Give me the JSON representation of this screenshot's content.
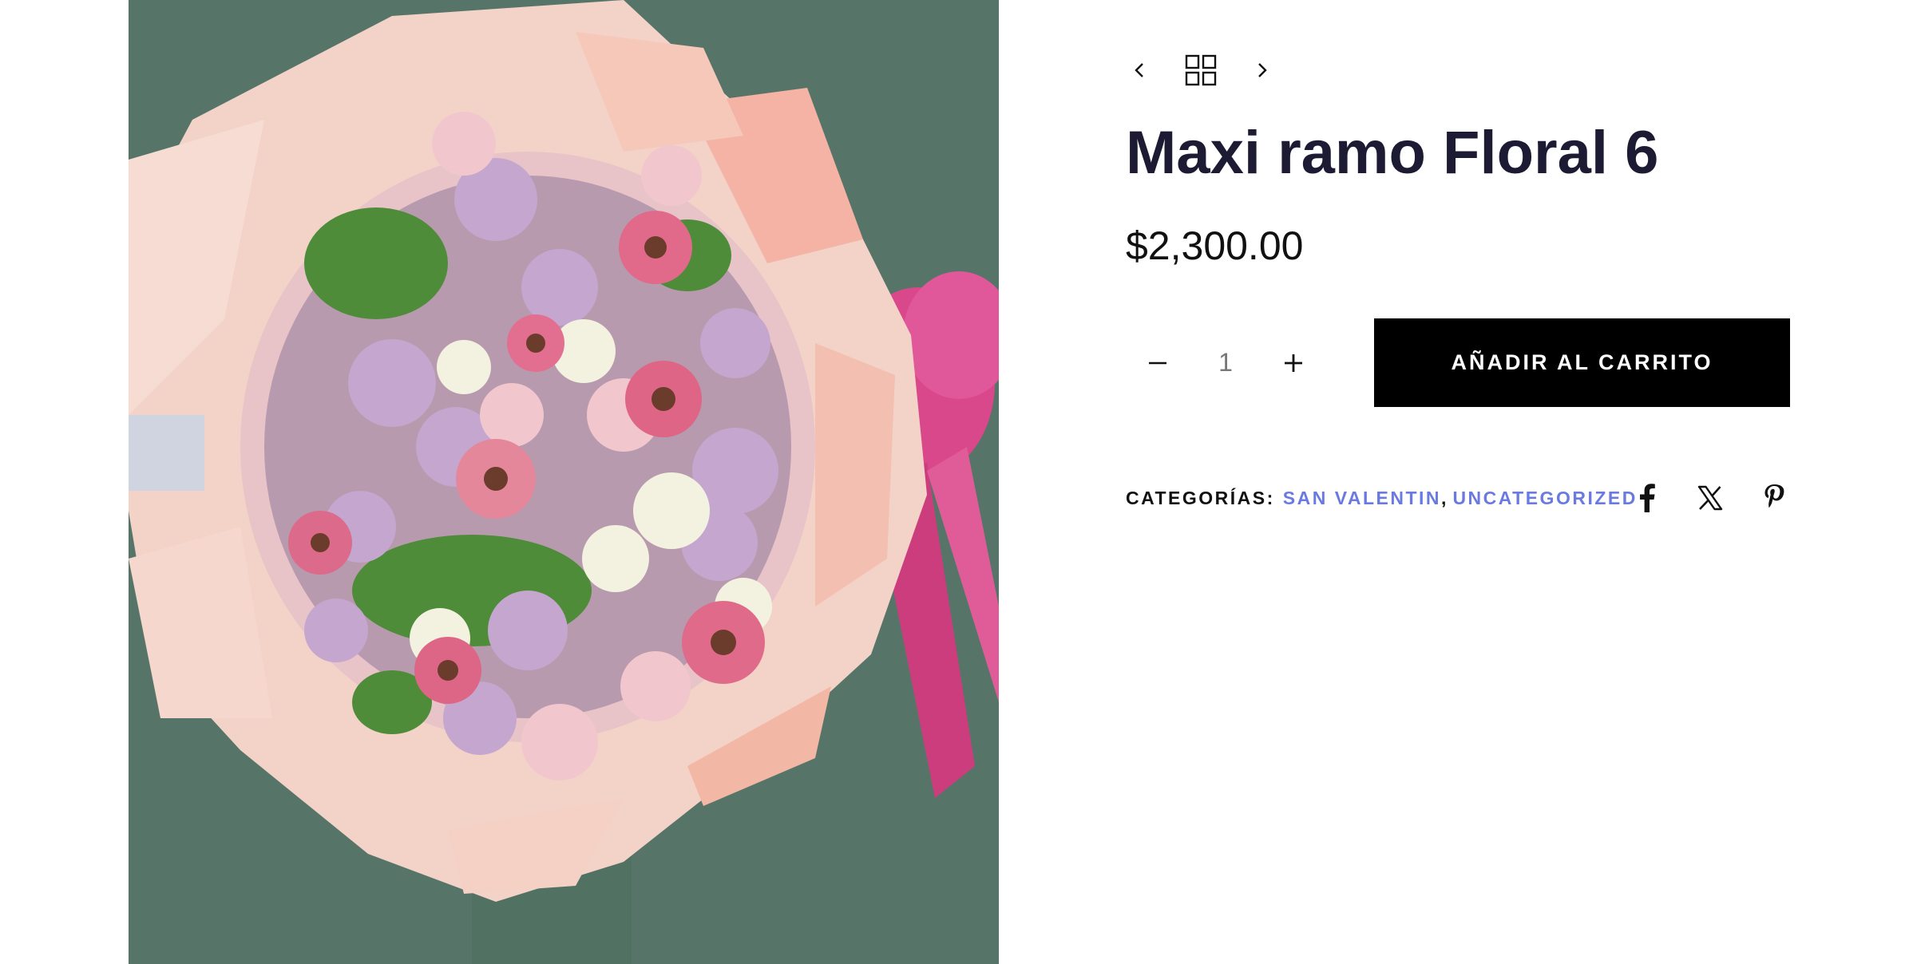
{
  "product": {
    "title": "Maxi ramo Floral 6",
    "price": "$2,300.00",
    "image_alt": "Maxi ramo Floral 6"
  },
  "navigation": {
    "prev_icon": "chevron-left-icon",
    "grid_icon": "grid-icon",
    "next_icon": "chevron-right-icon"
  },
  "cart": {
    "quantity": "1",
    "minus_icon": "minus-icon",
    "plus_icon": "plus-icon",
    "add_to_cart_label": "AÑADIR AL CARRITO"
  },
  "meta": {
    "categories_label": "CATEGORÍAS:",
    "categories": [
      "SAN VALENTIN",
      "UNCATEGORIZED"
    ],
    "separator": ","
  },
  "share": {
    "icons": [
      "facebook-icon",
      "x-icon",
      "pinterest-icon"
    ]
  },
  "colors": {
    "title": "#1c1b33",
    "link": "#6b7ae0",
    "button_bg": "#000000",
    "button_text": "#ffffff",
    "image_background": "#557466"
  }
}
